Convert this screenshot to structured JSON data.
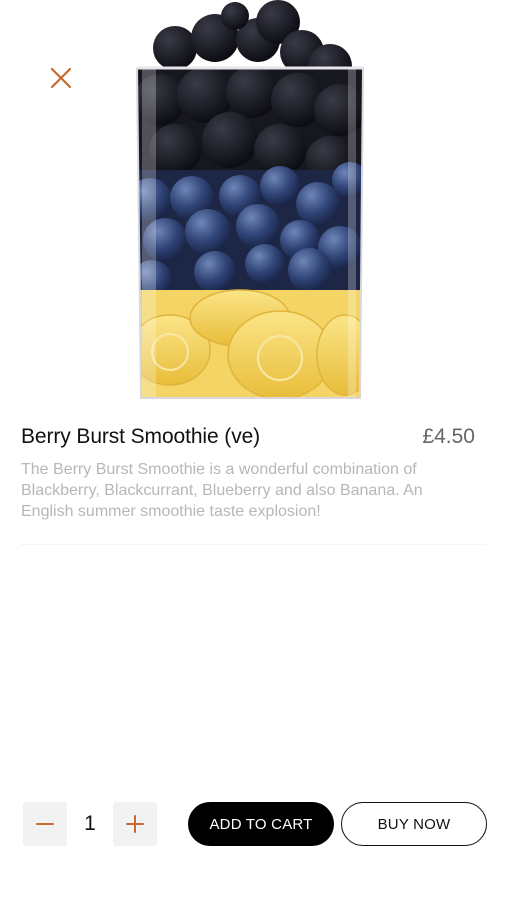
{
  "colors": {
    "accent": "#c9692d",
    "primary": "#000000",
    "muted": "#b7b7b7"
  },
  "product": {
    "name": "Berry Burst Smoothie (ve)",
    "price": "£4.50",
    "description": "The Berry Burst Smoothie is a wonderful combination of Blackberry, Blackcurrant, Blueberry and also Banana. An English summer smoothie taste explosion!",
    "image_icon": "smoothie-glass-image"
  },
  "quantity": {
    "value": "1",
    "minus_icon": "minus-icon",
    "plus_icon": "plus-icon"
  },
  "actions": {
    "add_to_cart": "ADD TO CART",
    "buy_now": "BUY NOW"
  },
  "close_icon": "close-icon"
}
